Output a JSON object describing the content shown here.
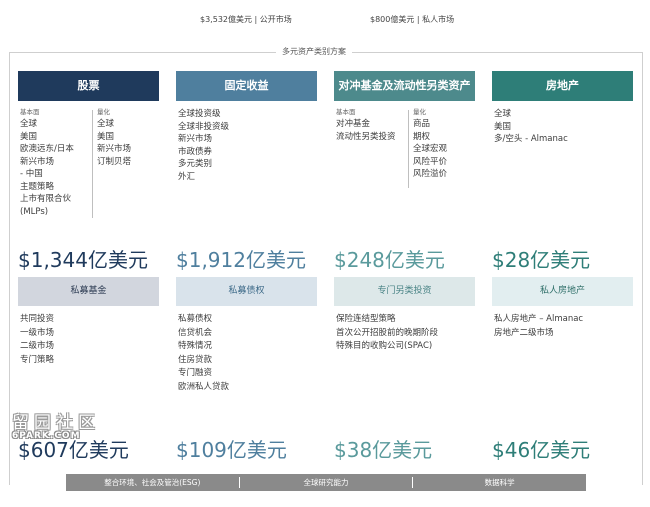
{
  "top": {
    "public_stat": "$3,532億美元 | 公开市场",
    "private_stat": "$800億美元 | 私人市场"
  },
  "frame_title": "多元资产类别方案",
  "columns": [
    {
      "title": "股票",
      "left": {
        "subhead": "基本面",
        "items": [
          "全球",
          "美国",
          "欧澳远东/日本",
          "新兴市场",
          "- 中国",
          "主题策略",
          "上市有限合伙 (MLPs)"
        ]
      },
      "right": {
        "subhead": "量化",
        "items": [
          "全球",
          "美国",
          "新兴市场",
          "订制贝塔"
        ]
      },
      "amount": "$1,344亿美元",
      "private_title": "私募基金",
      "private_items": [
        "共同投资",
        "一级市场",
        "二级市场",
        "专门策略"
      ],
      "private_amount": "$607亿美元"
    },
    {
      "title": "固定收益",
      "items": [
        "全球投资级",
        "全球非投资级",
        "新兴市场",
        "市政债券",
        "多元类别",
        "外汇"
      ],
      "amount": "$1,912亿美元",
      "private_title": "私募债权",
      "private_items": [
        "私募债权",
        "信贷机会",
        "特殊情况",
        "住房贷款",
        "专门融资",
        "欧洲私人贷款"
      ],
      "private_amount": "$109亿美元"
    },
    {
      "title": "对冲基金及流动性另类资产",
      "left": {
        "subhead": "基本面",
        "items": [
          "对冲基金",
          "流动性另类投资"
        ]
      },
      "right": {
        "subhead": "量化",
        "items": [
          "商品",
          "期权",
          "全球宏观",
          "风险平价",
          "风险溢价"
        ]
      },
      "amount": "$248亿美元",
      "private_title": "专门另类投资",
      "private_items": [
        "保险连结型策略",
        "首次公开招股前的晚期阶段",
        "特殊目的收购公司(SPAC)"
      ],
      "private_amount": "$38亿美元"
    },
    {
      "title": "房地产",
      "items": [
        "全球",
        "美国",
        "多/空头 - Almanac"
      ],
      "amount": "$28亿美元",
      "private_title": "私人房地产",
      "private_items": [
        "私人房地产 – Almanac",
        "房地产二级市场"
      ],
      "private_amount": "$46亿美元"
    }
  ],
  "bottom_bar": [
    "整合环境、社会及管治(ESG)",
    "全球研究能力",
    "数据科学"
  ],
  "watermark": {
    "top": "留园社区",
    "bottom": "6PARK.COM"
  },
  "colors": {
    "equity": "#1f3a5c",
    "fixed_income": "#4f7f9e",
    "hedge": "#4d8a8c",
    "real_estate": "#2e7e78",
    "bar": "#8a8a8a"
  }
}
